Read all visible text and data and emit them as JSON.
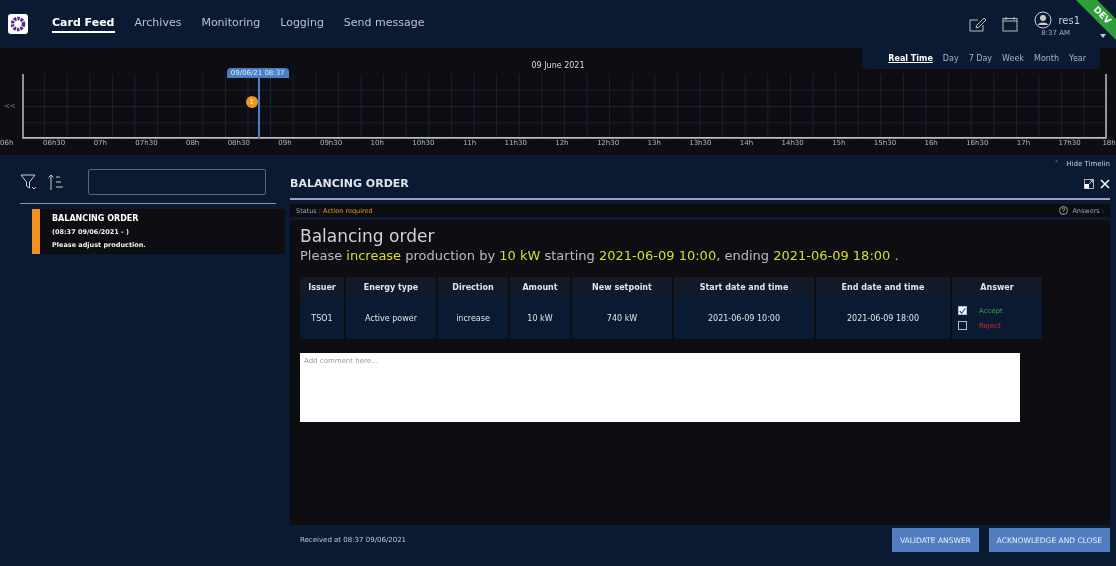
{
  "header": {
    "nav": [
      {
        "label": "Card Feed",
        "selected": true
      },
      {
        "label": "Archives",
        "selected": false
      },
      {
        "label": "Monitoring",
        "selected": false
      },
      {
        "label": "Logging",
        "selected": false
      },
      {
        "label": "Send message",
        "selected": false
      }
    ],
    "user": {
      "name": "res1",
      "time": "8:37 AM"
    },
    "env_badge": "DEV"
  },
  "timeline": {
    "date": "09 June 2021",
    "ranges": [
      {
        "label": "Real Time",
        "selected": true
      },
      {
        "label": "Day",
        "selected": false
      },
      {
        "label": "7 Day",
        "selected": false
      },
      {
        "label": "Week",
        "selected": false
      },
      {
        "label": "Month",
        "selected": false
      },
      {
        "label": "Year",
        "selected": false
      }
    ],
    "back": "<<",
    "cursor": "09/06/21 08:37",
    "markers": [
      {
        "count": "1",
        "color": "#f0961e"
      }
    ],
    "ticks": [
      "06h",
      "06h30",
      "07h",
      "07h30",
      "08h",
      "08h30",
      "09h",
      "09h30",
      "10h",
      "10h30",
      "11h",
      "11h30",
      "12h",
      "12h30",
      "13h",
      "13h30",
      "14h",
      "14h30",
      "15h",
      "15h30",
      "16h",
      "16h30",
      "17h",
      "17h30",
      "18h"
    ],
    "hide_toggle": {
      "icon": "˄",
      "label": "Hide Timelin"
    }
  },
  "feed": {
    "cards": [
      {
        "title": "BALANCING ORDER",
        "time": "(08:37 09/06/2021 - )",
        "summary": "Please adjust production.",
        "color": "#f0931e",
        "selected": true
      }
    ]
  },
  "card": {
    "title": "BALANCING ORDER",
    "status_label": "Status : ",
    "status": "Action required",
    "answers_label": "Answers :",
    "heading": "Balancing order",
    "sentence": [
      {
        "text": "Please ",
        "highlight": false
      },
      {
        "text": "increase",
        "highlight": true
      },
      {
        "text": " production by ",
        "highlight": false
      },
      {
        "text": "10 kW",
        "highlight": true
      },
      {
        "text": " starting ",
        "highlight": false
      },
      {
        "text": "2021-06-09 10:00",
        "highlight": true
      },
      {
        "text": ", ending ",
        "highlight": false
      },
      {
        "text": "2021-06-09 18:00",
        "highlight": true
      },
      {
        "text": " .",
        "highlight": false
      }
    ],
    "table": {
      "columns": [
        "Issuer",
        "Energy type",
        "Direction",
        "Amount",
        "New setpoint",
        "Start date and time",
        "End date and time",
        "Answer"
      ],
      "rows": [
        {
          "cells": [
            "TSO1",
            "Active power",
            "increase",
            "10 kW",
            "740 kW",
            "2021-06-09 10:00",
            "2021-06-09 18:00"
          ]
        }
      ]
    },
    "answers": [
      {
        "label": "Accept",
        "checked": true,
        "kind": "accept"
      },
      {
        "label": "Reject",
        "checked": false,
        "kind": "reject"
      }
    ],
    "comment": {
      "placeholder": "Add comment here..."
    },
    "received": "Received at 08:37 09/06/2021",
    "buttons": [
      "VALIDATE ANSWER",
      "ACKNOWLEDGE AND CLOSE"
    ]
  }
}
